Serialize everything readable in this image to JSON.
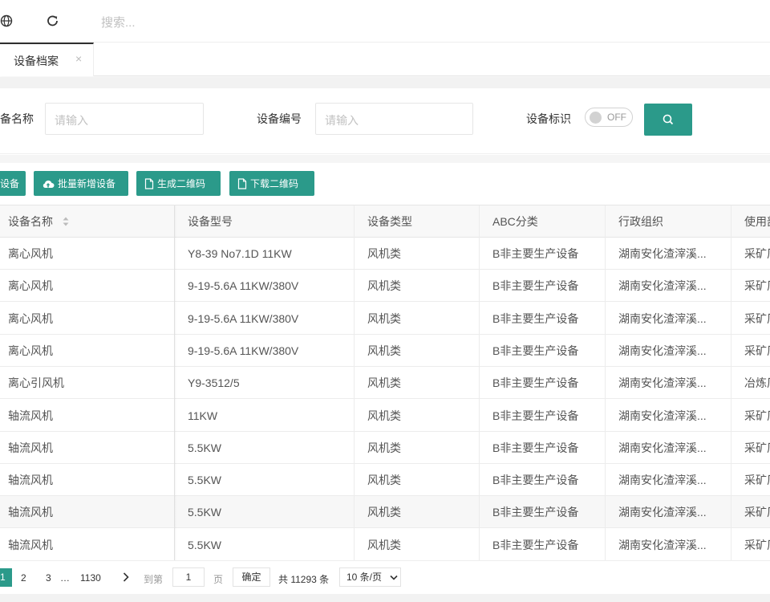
{
  "topbar": {
    "search_placeholder": "搜索..."
  },
  "tabs": [
    {
      "label": "设备档案",
      "close": "×"
    }
  ],
  "filter": {
    "name_label": "备名称",
    "name_placeholder": "请输入",
    "code_label": "设备编号",
    "code_placeholder": "请输入",
    "flag_label": "设备标识",
    "toggle_state": "OFF"
  },
  "toolbar": {
    "add_label": "设备",
    "batch_add_label": "批量新增设备",
    "gen_qr_label": "生成二维码",
    "download_qr_label": "下载二维码"
  },
  "table": {
    "headers": [
      "设备名称",
      "设备型号",
      "设备类型",
      "ABC分类",
      "行政组织",
      "使用部"
    ],
    "rows": [
      [
        "离心风机",
        "Y8-39 No7.1D 11KW",
        "风机类",
        "B非主要生产设备",
        "湖南安化渣滓溪...",
        "采矿厂"
      ],
      [
        "离心风机",
        "9-19-5.6A 11KW/380V",
        "风机类",
        "B非主要生产设备",
        "湖南安化渣滓溪...",
        "采矿厂"
      ],
      [
        "离心风机",
        "9-19-5.6A 11KW/380V",
        "风机类",
        "B非主要生产设备",
        "湖南安化渣滓溪...",
        "采矿厂"
      ],
      [
        "离心风机",
        "9-19-5.6A 11KW/380V",
        "风机类",
        "B非主要生产设备",
        "湖南安化渣滓溪...",
        "采矿厂"
      ],
      [
        "离心引风机",
        "Y9-3512/5",
        "风机类",
        "B非主要生产设备",
        "湖南安化渣滓溪...",
        "冶炼厂"
      ],
      [
        "轴流风机",
        "11KW",
        "风机类",
        "B非主要生产设备",
        "湖南安化渣滓溪...",
        "采矿厂"
      ],
      [
        "轴流风机",
        "5.5KW",
        "风机类",
        "B非主要生产设备",
        "湖南安化渣滓溪...",
        "采矿厂"
      ],
      [
        "轴流风机",
        "5.5KW",
        "风机类",
        "B非主要生产设备",
        "湖南安化渣滓溪...",
        "采矿厂"
      ],
      [
        "轴流风机",
        "5.5KW",
        "风机类",
        "B非主要生产设备",
        "湖南安化渣滓溪...",
        "采矿厂"
      ],
      [
        "轴流风机",
        "5.5KW",
        "风机类",
        "B非主要生产设备",
        "湖南安化渣滓溪...",
        "采矿厂"
      ]
    ]
  },
  "pager": {
    "current": "1",
    "pages": [
      "2",
      "3"
    ],
    "ellipsis": "…",
    "last": "1130",
    "goto_label": "到第",
    "goto_value": "1",
    "page_unit": "页",
    "ok_label": "确定",
    "total_text": "共 11293 条",
    "page_size": "10 条/页"
  },
  "colors": {
    "accent": "#2b9a8a"
  }
}
